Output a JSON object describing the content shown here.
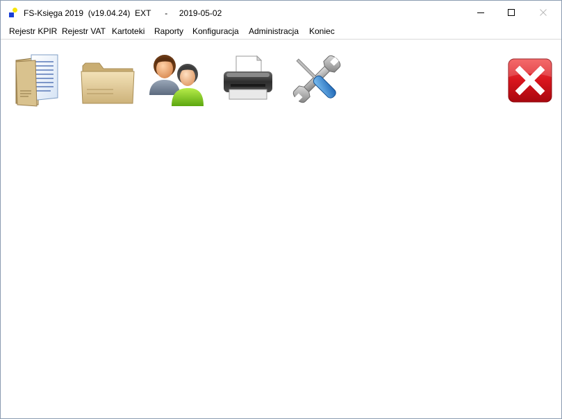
{
  "window": {
    "title": "FS-Księga 2019  (v19.04.24)  EXT      -     2019-05-02",
    "controls": {
      "minimize_icon": "minimize-icon",
      "maximize_icon": "maximize-icon",
      "close_icon": "close-icon"
    }
  },
  "menu": {
    "items": [
      {
        "label": "Rejestr KPIR"
      },
      {
        "label": "Rejestr VAT"
      },
      {
        "label": "Kartoteki"
      },
      {
        "label": "Raporty"
      },
      {
        "label": "Konfiguracja"
      },
      {
        "label": "Administracja"
      },
      {
        "label": "Koniec"
      }
    ]
  },
  "toolbar": {
    "buttons": [
      {
        "icon": "documents-icon"
      },
      {
        "icon": "folder-icon"
      },
      {
        "icon": "users-icon"
      },
      {
        "icon": "printer-icon"
      },
      {
        "icon": "tools-icon"
      },
      {
        "icon": "exit-icon"
      }
    ]
  },
  "colors": {
    "accent_blue": "#1a3fd6",
    "accent_yellow": "#f7e50a",
    "exit_red": "#d8151d",
    "window_border": "#8a9bb0"
  }
}
